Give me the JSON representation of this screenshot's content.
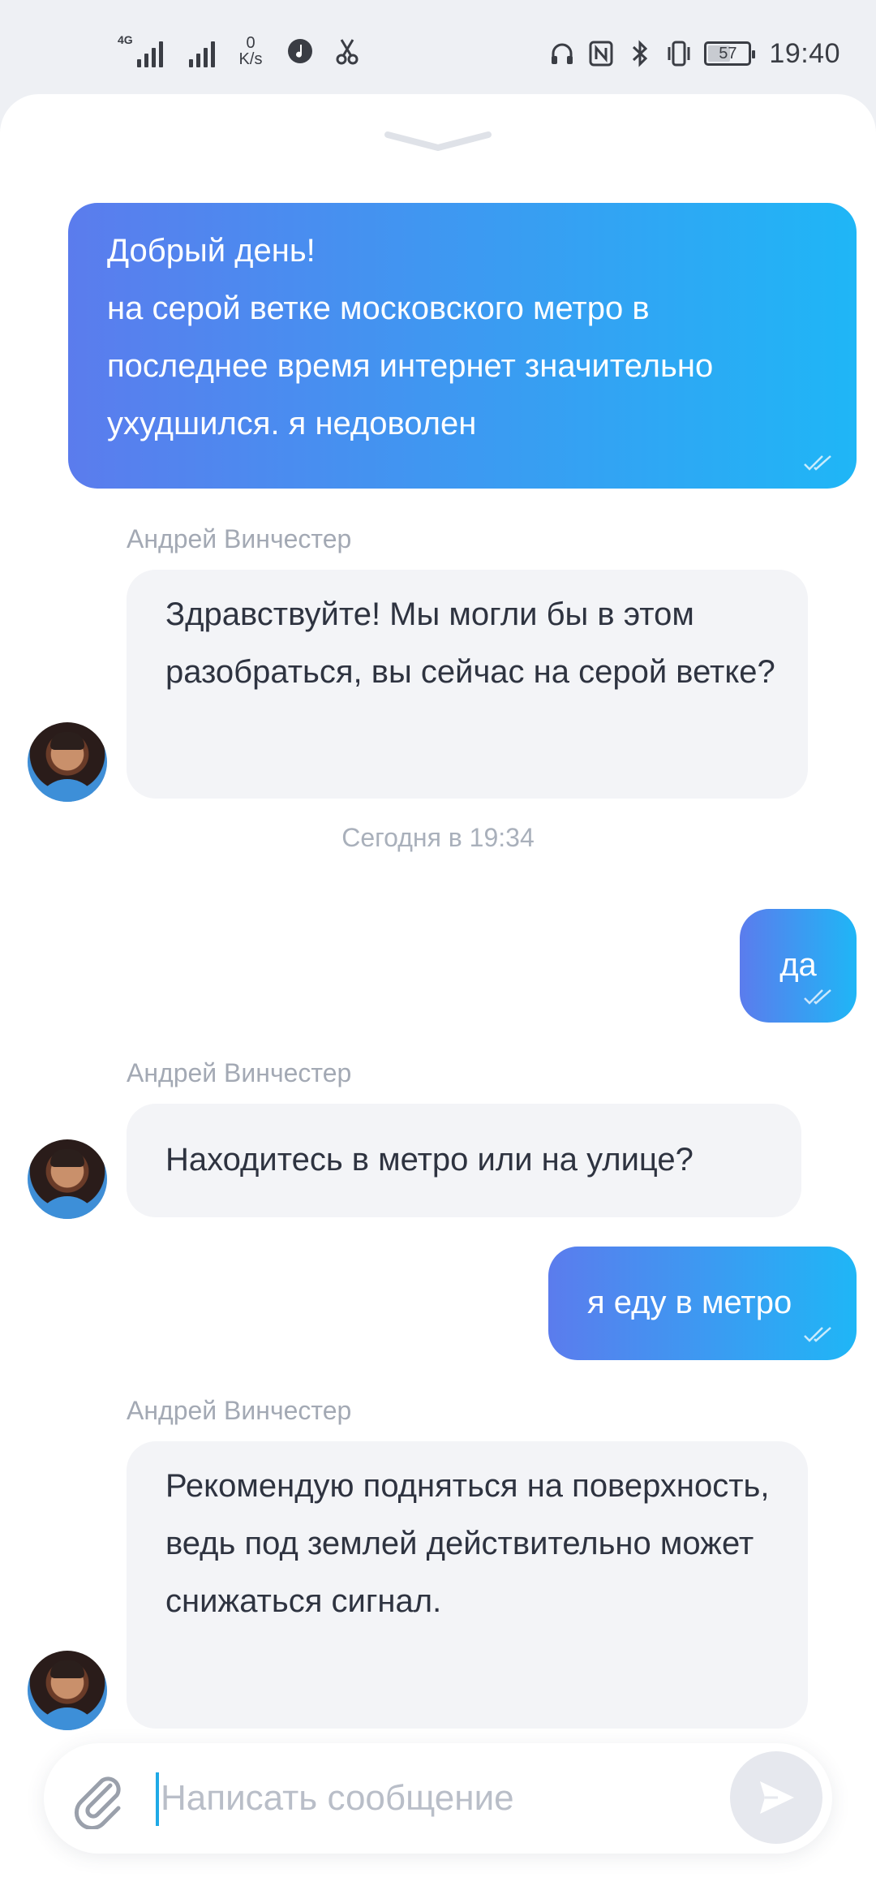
{
  "status_bar": {
    "network_type": "4G",
    "speed_value": "0",
    "speed_unit": "K/s",
    "battery_level": "57",
    "time": "19:40",
    "icons": [
      "signal-icon",
      "signal-icon",
      "music-icon",
      "scissors-icon",
      "headphones-icon",
      "nfc-icon",
      "bluetooth-icon",
      "vibrate-icon",
      "battery-icon"
    ]
  },
  "chat": {
    "messages": [
      {
        "direction": "out",
        "text": "Добрый день!\nна серой ветке московского метро в последнее время интернет значительно ухудшился. я недоволен",
        "status": "read"
      },
      {
        "direction": "in",
        "sender": "Андрей Винчестер",
        "text": "Здравствуйте! Мы могли бы в этом разобраться, вы сейчас на серой ветке?"
      },
      {
        "direction": "out",
        "text": "да",
        "status": "read"
      },
      {
        "direction": "in",
        "sender": "Андрей Винчестер",
        "text": "Находитесь в метро или на улице?"
      },
      {
        "direction": "out",
        "text": "я еду в метро",
        "status": "read"
      },
      {
        "direction": "in",
        "sender": "Андрей Винчестер",
        "text": "Рекомендую подняться на поверхность, ведь под землей действительно может снижаться сигнал."
      }
    ],
    "timestamp_label": "Сегодня в 19:34"
  },
  "composer": {
    "placeholder": "Написать сообщение",
    "value": ""
  },
  "colors": {
    "outgoing_gradient_start": "#5b7ced",
    "outgoing_gradient_end": "#1fb6f6",
    "incoming_bg": "#f3f4f7",
    "caret": "#1fa9e6"
  }
}
